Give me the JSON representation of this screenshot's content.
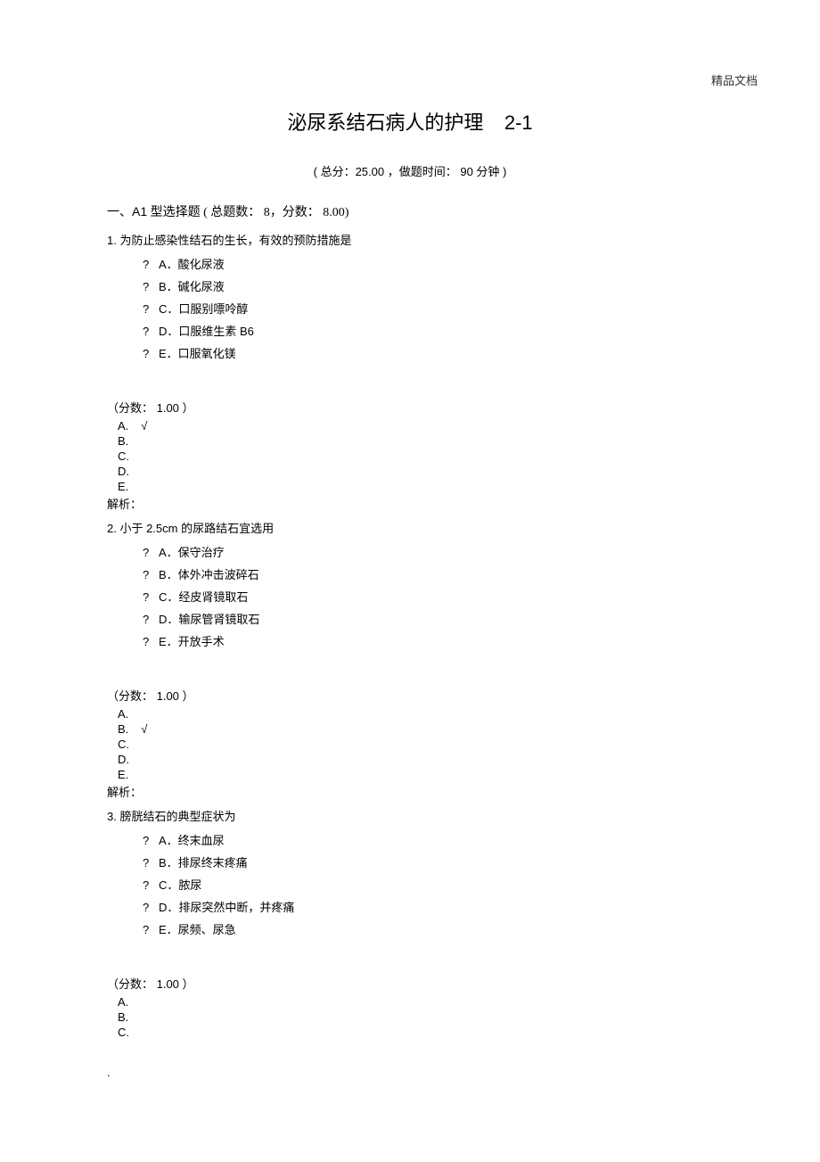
{
  "header_tag": "精品文档",
  "title_main": "泌尿系结石病人的护理",
  "title_suffix": "2-1",
  "subtitle": "( 总分：25.00 ，做题时间： 90 分钟 )",
  "section_header_cn1": "一、",
  "section_header_en": "A1",
  "section_header_cn2": " 型选择题   ( 总题数： 8，分数： 8.00)",
  "questions": [
    {
      "stem": "1. 为防止感染性结石的生长，有效的预防措施是",
      "options": [
        "A．酸化尿液",
        "B．碱化尿液",
        "C．口服别嘌呤醇",
        "D．口服维生素  B6",
        "E．口服氧化镁"
      ],
      "score": "（分数： 1.00 ）",
      "answers": [
        "A.",
        "B.",
        "C.",
        "D.",
        "E."
      ],
      "correct": "A",
      "analysis": "解析："
    },
    {
      "stem": "2. 小于 2.5cm 的尿路结石宜选用",
      "options": [
        "A．保守治疗",
        "B．体外冲击波碎石",
        "C．经皮肾镜取石",
        "D．输尿管肾镜取石",
        "E．开放手术"
      ],
      "score": "（分数： 1.00 ）",
      "answers": [
        "A.",
        "B.",
        "C.",
        "D.",
        "E."
      ],
      "correct": "B",
      "analysis": "解析："
    },
    {
      "stem": "3. 膀胱结石的典型症状为",
      "options": [
        "A．终末血尿",
        "B．排尿终末疼痛",
        "C．脓尿",
        "D．排尿突然中断，并疼痛",
        "E．尿频、尿急"
      ],
      "score": "（分数： 1.00 ）",
      "answers": [
        "A.",
        "B.",
        "C."
      ],
      "correct": "",
      "analysis": ""
    }
  ],
  "check_mark": "√",
  "qmark": "?",
  "footer": "."
}
